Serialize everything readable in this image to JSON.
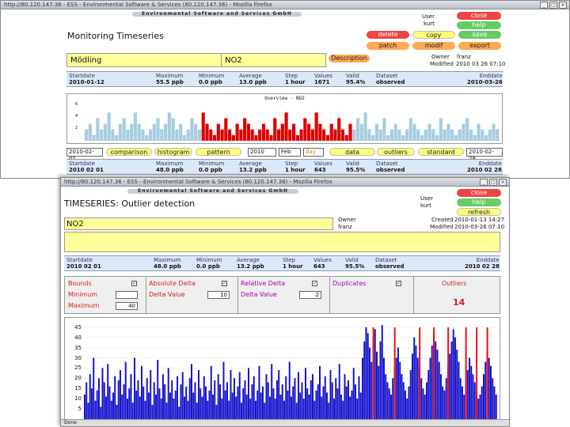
{
  "win1": {
    "titlebar": "http://80.120.147.36 - ESS - Environmental Software & Services (80.120.147.36) - Mozilla Firefox",
    "banner": "Environmental Software and Services GmbH",
    "page_title": "Monitoring Timeseries",
    "station": "Mödling",
    "parameter": "NO2",
    "description_button": "Description",
    "user_label": "User",
    "user_value": "kurt",
    "owner_label": "Owner",
    "owner_value": "franz",
    "modified_label": "Modified",
    "modified_value": "2010 03 26 07:10",
    "buttons": {
      "close": "close",
      "help": "help",
      "delete": "delete",
      "copy": "copy",
      "save": "save",
      "patch": "patch",
      "mod": "modif",
      "export": "export"
    },
    "stats1": {
      "startdate_h": "Startdate",
      "startdate_v": "2010-01-12",
      "maximum_h": "Maximum",
      "maximum_v": "55.5 ppb",
      "minimum_h": "Minimum",
      "minimum_v": "0.0 ppb",
      "average_h": "Average",
      "average_v": "13.0 ppb",
      "step_h": "Step",
      "step_v": "1 hour",
      "values_h": "Values",
      "values_v": "1671",
      "valid_h": "Valid",
      "valid_v": "95.4%",
      "dataset_h": "Dataset",
      "dataset_v": "observed",
      "enddate_h": "Enddate",
      "enddate_v": "2010-03-26"
    },
    "overview_title": "Overview - NO2",
    "overview_ticks": [
      "6",
      "4",
      "2"
    ],
    "controls": {
      "date_from": "2010-02-01",
      "comparison": "comparison",
      "histogram": "histogram",
      "pattern": "pattern",
      "year": "2010",
      "month": "Feb",
      "unit": "day",
      "data": "data",
      "outliers": "outliers",
      "standard": "standard",
      "date_to": "2010-02-28"
    },
    "stats2": {
      "startdate_h": "Startdate",
      "startdate_v": "2010 02 01",
      "maximum_h": "Maximum",
      "maximum_v": "48.0 ppb",
      "minimum_h": "Minimum",
      "minimum_v": "0.0 ppb",
      "average_h": "Average",
      "average_v": "13.2 ppb",
      "step_h": "Step",
      "step_v": "1 hour",
      "values_h": "Values",
      "values_v": "643",
      "valid_h": "Valid",
      "valid_v": "95.5%",
      "dataset_h": "Dataset",
      "dataset_v": "observed",
      "enddate_h": "Enddate",
      "enddate_v": "2010 02 28"
    }
  },
  "win2": {
    "titlebar": "http://80.120.147.36 - ESS - Environmental Software & Services (80.120.147.36) - Mozilla Firefox",
    "banner": "Environmental Software and Services GmbH",
    "page_title": "TIMESERIES: Outlier detection",
    "user_label": "User",
    "user_value": "kurt",
    "buttons": {
      "close": "close",
      "help": "help",
      "refresh": "refresh"
    },
    "parameter": "NO2",
    "owner_label": "Owner",
    "owner_value": "franz",
    "created_label": "Created",
    "created_value": "2010-01-13 14:27",
    "modified_label": "Modified",
    "modified_value": "2010-03-26 07:10",
    "stats": {
      "startdate_h": "Startdate",
      "startdate_v": "2010 02 01",
      "maximum_h": "Maximum",
      "maximum_v": "48.0 ppb",
      "minimum_h": "Minimum",
      "minimum_v": "0.0 ppb",
      "average_h": "Average",
      "average_v": "13.2 ppb",
      "step_h": "Step",
      "step_v": "1 hour",
      "values_h": "Values",
      "values_v": "643",
      "valid_h": "Valid",
      "valid_v": "95.5%",
      "dataset_h": "Dataset",
      "dataset_v": "observed",
      "enddate_h": "Enddate",
      "enddate_v": "2010 02 28"
    },
    "settings": {
      "bounds": "Bounds",
      "minimum": "Minimum",
      "maximum": "Maximum",
      "maximum_value": "40",
      "absolute_delta": "Absolute Delta",
      "delta_value_1": "Delta Value",
      "delta_value_1_value": "10",
      "relative_delta": "Relative Delta",
      "delta_value_2": "Delta Value",
      "delta_value_2_value": "2",
      "duplicates": "Duplicates",
      "outliers_label": "Outliers",
      "outliers_count": "14"
    },
    "chart_ticks": [
      "45",
      "40",
      "35",
      "30",
      "25",
      "20",
      "15",
      "10",
      "5"
    ],
    "status": "Done"
  },
  "colors": {
    "series_normal": "#a6cde0",
    "series_selected": "#dd0000",
    "series_blue": "#1010cc",
    "outlier": "#ee1111",
    "panel_yellow": "#ffff99",
    "stats_blue": "#dbe8f8"
  },
  "chart_data": [
    {
      "type": "bar",
      "title": "Overview - NO2",
      "ylim": [
        0,
        7
      ],
      "note_series": [
        {
          "name": "",
          "values": [
            2,
            3,
            1,
            4,
            2,
            3,
            5,
            2,
            1,
            3,
            4,
            2,
            3,
            5,
            3,
            2,
            1,
            2,
            3,
            4,
            2,
            3,
            5,
            4,
            2,
            3,
            1,
            2,
            4,
            3,
            2,
            5,
            3,
            2,
            1,
            3,
            2,
            4,
            2,
            1,
            3,
            2,
            4,
            3,
            2,
            1,
            2,
            3,
            2,
            1,
            4,
            2,
            3,
            5,
            2,
            3,
            1,
            2,
            4,
            3,
            2,
            5,
            3,
            2,
            1,
            3,
            2,
            4,
            2,
            1,
            3,
            2,
            4,
            3,
            5,
            2,
            1,
            3,
            2,
            4,
            1,
            2,
            3,
            2,
            1,
            2,
            4,
            3,
            2,
            1,
            2,
            3,
            2,
            1,
            4,
            2,
            3,
            2,
            1,
            2,
            3,
            4,
            2,
            1,
            3,
            2,
            1,
            2,
            3,
            2
          ]
        }
      ]
    },
    {
      "type": "bar",
      "title": "",
      "ylim": [
        0,
        48
      ],
      "series": [
        {
          "name": "",
          "values": [
            12,
            18,
            8,
            22,
            15,
            30,
            9,
            14,
            20,
            6,
            25,
            18,
            11,
            27,
            16,
            9,
            13,
            21,
            7,
            19,
            24,
            12,
            17,
            28,
            10,
            15,
            22,
            8,
            30,
            14,
            19,
            11,
            26,
            16,
            9,
            20,
            13,
            24,
            7,
            18,
            12,
            29,
            15,
            10,
            22,
            17,
            8,
            25,
            13,
            19,
            10,
            14,
            21,
            6,
            17,
            23,
            11,
            16,
            9,
            20,
            27,
            13,
            18,
            8,
            24,
            15,
            11,
            21,
            16,
            9,
            14,
            26,
            12,
            19,
            7,
            22,
            17,
            10,
            28,
            14,
            18,
            9,
            24,
            13,
            20,
            11,
            16,
            23,
            8,
            15,
            19,
            12,
            25,
            10,
            17,
            21,
            9,
            14,
            26,
            13,
            16,
            8,
            22,
            18,
            11,
            27,
            15,
            10,
            19,
            24,
            12,
            17,
            9,
            21,
            14,
            28,
            11,
            16,
            20,
            8,
            23,
            13,
            18,
            10,
            25,
            15,
            12,
            19,
            22,
            9,
            14,
            17,
            26,
            11,
            16,
            21,
            13,
            8,
            24,
            18,
            10,
            20,
            15,
            27,
            12,
            9,
            22,
            16,
            19,
            11,
            14,
            25,
            17,
            10,
            21,
            13,
            30,
            38,
            45,
            42,
            35,
            28,
            40,
            44,
            33,
            26,
            38,
            46,
            30,
            22,
            18,
            15,
            12,
            20,
            25,
            30,
            35,
            28,
            22,
            18,
            14,
            10,
            16,
            24,
            32,
            40,
            36,
            30,
            26,
            20,
            15,
            12,
            18,
            24,
            30,
            36,
            42,
            38,
            34,
            28,
            22,
            16,
            14,
            20,
            26,
            32,
            38,
            44,
            40,
            34,
            28,
            20,
            16,
            12,
            18,
            24,
            30,
            26,
            22,
            18,
            14,
            10,
            12,
            16,
            22,
            28,
            34,
            30,
            26,
            20,
            16,
            12
          ]
        }
      ],
      "outlier_indices": [
        162,
        174,
        188,
        196,
        204,
        214,
        220,
        226,
        232,
        238,
        244,
        248,
        252,
        256
      ]
    }
  ]
}
